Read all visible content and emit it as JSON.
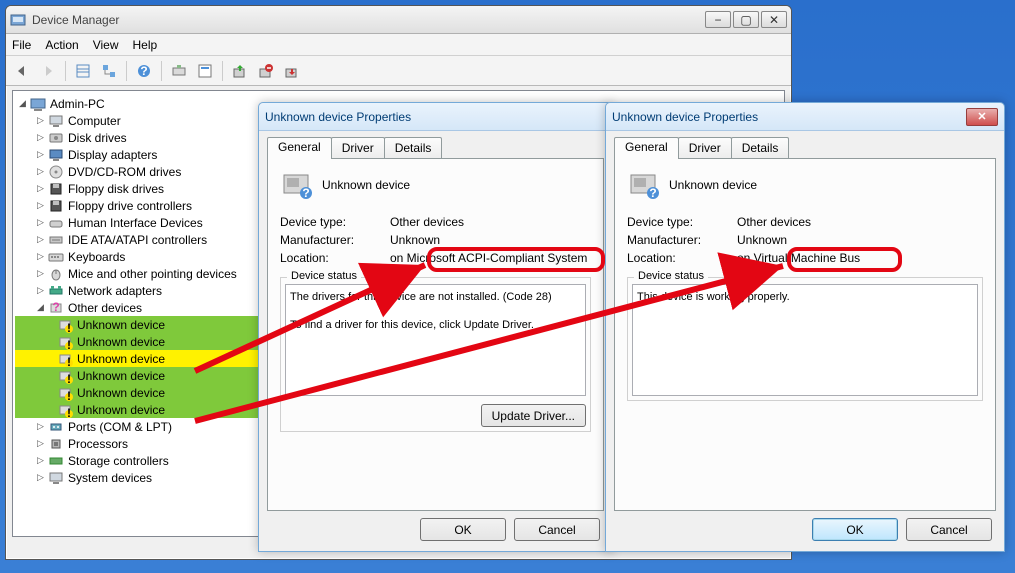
{
  "window": {
    "title": "Device Manager",
    "menu": {
      "file": "File",
      "action": "Action",
      "view": "View",
      "help": "Help"
    },
    "buttons": {
      "minimize": "−",
      "maximize": "▢",
      "close": "✕"
    }
  },
  "tree": {
    "root": "Admin-PC",
    "categories": [
      "Computer",
      "Disk drives",
      "Display adapters",
      "DVD/CD-ROM drives",
      "Floppy disk drives",
      "Floppy drive controllers",
      "Human Interface Devices",
      "IDE ATA/ATAPI controllers",
      "Keyboards",
      "Mice and other pointing devices",
      "Network adapters",
      "Other devices",
      "Ports (COM & LPT)",
      "Processors",
      "Storage controllers",
      "System devices"
    ],
    "unknown_devices": [
      "Unknown device",
      "Unknown device",
      "Unknown device",
      "Unknown device",
      "Unknown device",
      "Unknown device"
    ]
  },
  "dialog1": {
    "title": "Unknown device Properties",
    "tabs": {
      "general": "General",
      "driver": "Driver",
      "details": "Details"
    },
    "device_name": "Unknown device",
    "rows": {
      "type_label": "Device type:",
      "type_value": "Other devices",
      "mfg_label": "Manufacturer:",
      "mfg_value": "Unknown",
      "loc_label": "Location:",
      "loc_value": "on Microsoft ACPI-Compliant System"
    },
    "status_legend": "Device status",
    "status_text": "The drivers for this device are not installed. (Code 28)\n\nTo find a driver for this device, click Update Driver.",
    "update_btn": "Update Driver...",
    "ok": "OK",
    "cancel": "Cancel"
  },
  "dialog2": {
    "title": "Unknown device Properties",
    "tabs": {
      "general": "General",
      "driver": "Driver",
      "details": "Details"
    },
    "device_name": "Unknown device",
    "rows": {
      "type_label": "Device type:",
      "type_value": "Other devices",
      "mfg_label": "Manufacturer:",
      "mfg_value": "Unknown",
      "loc_label": "Location:",
      "loc_value": "on Virtual Machine Bus"
    },
    "status_legend": "Device status",
    "status_text": "This device is working properly.",
    "ok": "OK",
    "cancel": "Cancel"
  }
}
